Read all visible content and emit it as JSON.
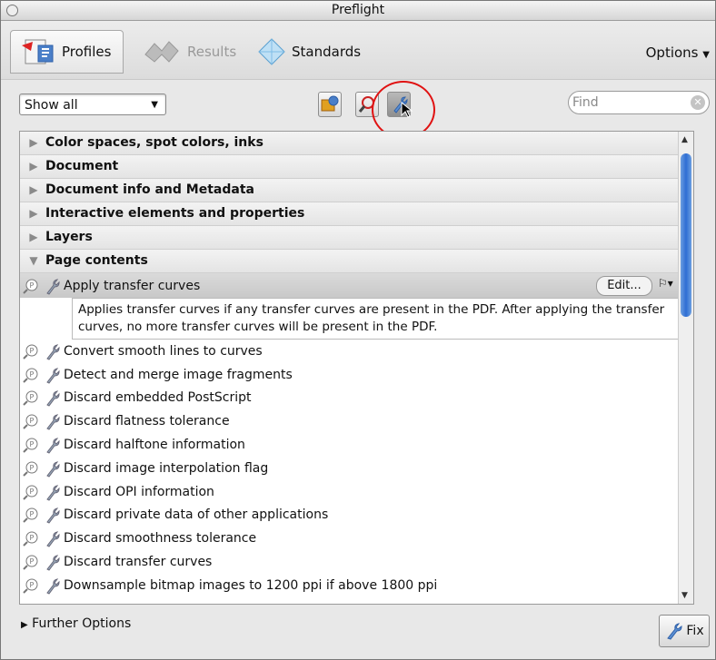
{
  "window": {
    "title": "Preflight"
  },
  "tabs": [
    {
      "label": "Profiles",
      "icon": "profiles-icon",
      "active": true
    },
    {
      "label": "Results",
      "icon": "results-icon",
      "active": false
    },
    {
      "label": "Standards",
      "icon": "standards-icon",
      "active": false
    }
  ],
  "options_label": "Options",
  "show_select": {
    "value": "Show all"
  },
  "toolbar_buttons": [
    "profiles-view-icon",
    "checks-view-icon",
    "fixups-view-icon"
  ],
  "find": {
    "placeholder": "Find"
  },
  "categories_top": [
    "Color spaces, spot colors, inks",
    "Document",
    "Document info and Metadata",
    "Interactive elements and properties",
    "Layers"
  ],
  "expanded_category": "Page contents",
  "selected_fixup": {
    "label": "Apply transfer curves",
    "edit_label": "Edit...",
    "description": "Applies transfer curves if any transfer curves are present in the PDF. After applying the transfer curves, no more transfer curves will be present in the PDF."
  },
  "fixups": [
    "Convert smooth lines to curves",
    "Detect and merge image fragments",
    "Discard embedded PostScript",
    "Discard flatness tolerance",
    "Discard halftone information",
    "Discard image interpolation flag",
    "Discard OPI information",
    "Discard private data of other applications",
    "Discard smoothness tolerance",
    "Discard transfer curves",
    "Downsample bitmap images to 1200 ppi if above 1800 ppi"
  ],
  "further_options": "Further Options",
  "fix_button": "Fix",
  "colors": {
    "accent": "#2e6ed4",
    "highlight_ring": "#e01212"
  }
}
